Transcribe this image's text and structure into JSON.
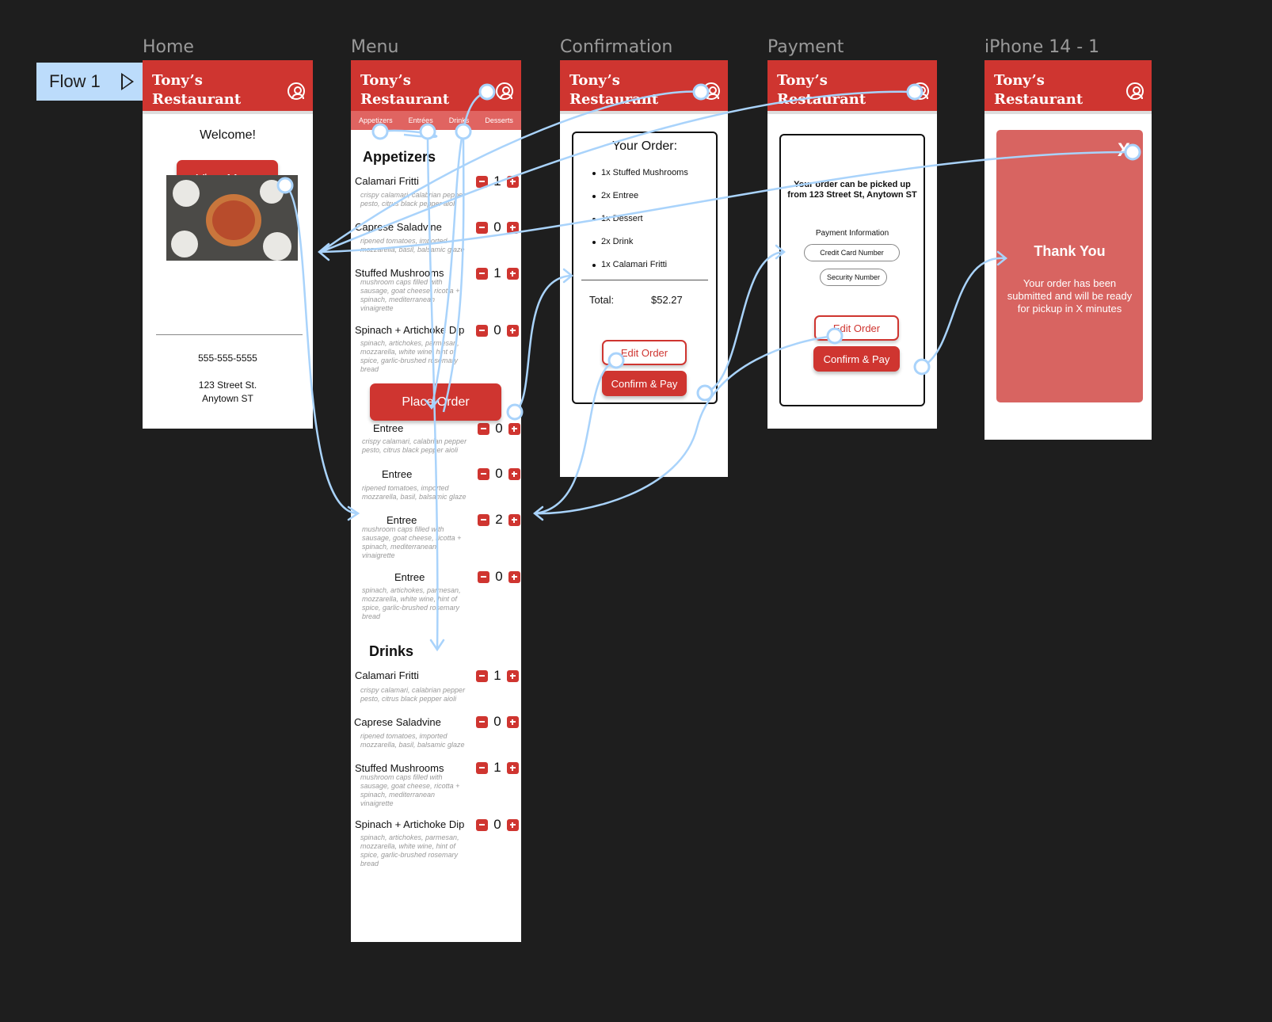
{
  "flow": {
    "label": "Flow 1",
    "icon": "play-icon"
  },
  "frames": {
    "home": "Home",
    "menu": "Menu",
    "confirmation": "Confirmation",
    "payment": "Payment",
    "iphone": "iPhone 14 - 1"
  },
  "brand": {
    "name": "Tony’s Restaurant",
    "accent": "#cf3530",
    "tab_bg": "#e06461",
    "card_bg": "#d86461",
    "flow_color": "#a9d3fb"
  },
  "home": {
    "welcome": "Welcome!",
    "view_menu": "View Menu",
    "image": "pizza-photo",
    "phone": "555-555-5555",
    "address_line1": "123 Street St.",
    "address_line2": "Anytown ST"
  },
  "menu": {
    "tabs": [
      "Appetizers",
      "Entrées",
      "Drinks",
      "Desserts"
    ],
    "appetizers_title": "Appetizers",
    "drinks_title": "Drinks",
    "place_order": "Place Order",
    "appetizers": [
      {
        "name": "Calamari Fritti",
        "desc": "crispy calamari, calabrian pepper pesto, citrus black pepper aioli",
        "qty": "1"
      },
      {
        "name": "Caprese Saladvine",
        "desc": "ripened tomatoes, imported mozzarella, basil, balsamic glaze",
        "qty": "0"
      },
      {
        "name": "Stuffed Mushrooms",
        "desc": "mushroom caps filled with sausage, goat cheese, ricotta + spinach, mediterranean vinaigrette",
        "qty": "1"
      },
      {
        "name": "Spinach + Artichoke Dip",
        "desc": "spinach, artichokes, parmesan, mozzarella, white wine, hint of spice, garlic-brushed rosemary bread",
        "qty": "0"
      }
    ],
    "entrees": [
      {
        "name": "Entree",
        "desc": "crispy calamari, calabrian pepper pesto, citrus black pepper aioli",
        "qty": "0"
      },
      {
        "name": "Entree",
        "desc": "ripened tomatoes, imported mozzarella, basil, balsamic glaze",
        "qty": "0"
      },
      {
        "name": "Entree",
        "desc": "mushroom caps filled with sausage, goat cheese, ricotta + spinach, mediterranean vinaigrette",
        "qty": "2"
      },
      {
        "name": "Entree",
        "desc": "spinach, artichokes, parmesan, mozzarella, white wine, hint of spice, garlic-brushed rosemary bread",
        "qty": "0"
      }
    ],
    "drinks": [
      {
        "name": "Calamari Fritti",
        "desc": "crispy calamari, calabrian pepper pesto, citrus black pepper aioli",
        "qty": "1"
      },
      {
        "name": "Caprese Saladvine",
        "desc": "ripened tomatoes, imported mozzarella, basil, balsamic glaze",
        "qty": "0"
      },
      {
        "name": "Stuffed Mushrooms",
        "desc": "mushroom caps filled with sausage, goat cheese, ricotta + spinach, mediterranean vinaigrette",
        "qty": "1"
      },
      {
        "name": "Spinach + Artichoke Dip",
        "desc": "spinach, artichokes, parmesan, mozzarella, white wine, hint of spice, garlic-brushed rosemary bread",
        "qty": "0"
      }
    ]
  },
  "confirmation": {
    "title": "Your Order:",
    "items": [
      "1x Stuffed Mushrooms",
      "2x Entree",
      "1x Dessert",
      "2x Drink",
      "1x Calamari Fritti"
    ],
    "total_label": "Total:",
    "total_value": "$52.27",
    "edit": "Edit Order",
    "confirm": "Confirm & Pay"
  },
  "payment": {
    "pickup": "Your order can be picked up from 123 Street St, Anytown ST",
    "info_title": "Payment Information",
    "card_field": "Credit Card Number",
    "security_field": "Security Number",
    "edit": "Edit Order",
    "confirm": "Confirm & Pay"
  },
  "thanks": {
    "close": "X",
    "title": "Thank You",
    "message": "Your order has been submitted and will be ready for pickup in X minutes"
  }
}
